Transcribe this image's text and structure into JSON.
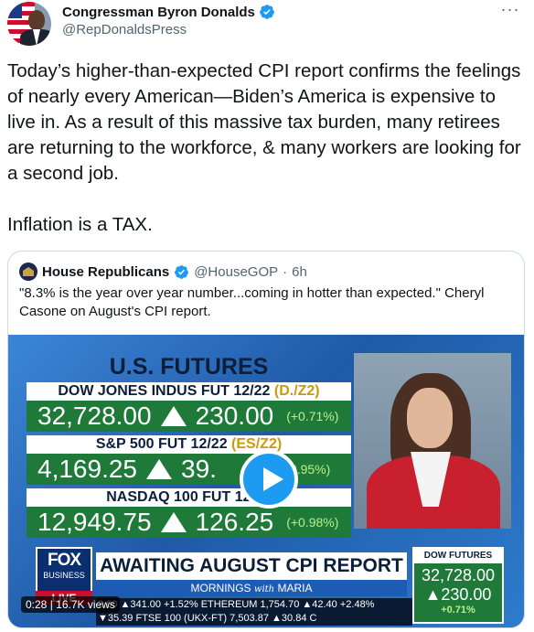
{
  "author": {
    "display_name": "Congressman Byron Donalds",
    "handle": "@RepDonaldsPress",
    "more_label": "···"
  },
  "tweet": {
    "text": "Today’s higher-than-expected CPI report confirms the feelings of nearly every American—Biden’s America is expensive to live in. As a result of this massive tax burden, many retirees are returning to the workforce, & many workers are looking for a second job.\n\nInflation is a TAX."
  },
  "quote": {
    "display_name": "House Republicans",
    "handle": "@HouseGOP",
    "separator": "·",
    "time": "6h",
    "text": "\"8.3% is the year over year number...coming in hotter than expected.\" Cheryl Casone on August's CPI report."
  },
  "video": {
    "futures_title": "U.S. FUTURES",
    "rows": [
      {
        "label": "DOW JONES INDUS FUT 12/22 ",
        "ticker": "(D./Z2)",
        "value": "32,728.00",
        "change": "230.00",
        "pct": "(+0.71%)"
      },
      {
        "label": "S&P 500 FUT 12/22 ",
        "ticker": "(ES/Z2)",
        "value": "4,169.25",
        "change": "39.",
        "pct": "0.95%)"
      },
      {
        "label": "NASDAQ 100 FUT 12/22",
        "ticker": "",
        "value": "12,949.75",
        "change": "126.25",
        "pct": "(+0.98%)"
      }
    ],
    "fox": "FOX",
    "business": "BUSINESS",
    "live": "LIVE",
    "headline": "AWAITING AUGUST CPI REPORT",
    "show_a": "MORNINGS ",
    "show_b": "with",
    "show_c": " MARIA",
    "ticker_line1": "2.00 ▲341.00 +1.52% ETHEREUM 1,754.70 ▲42.40 +2.48%",
    "ticker_line2": "▼35.39 FTSE 100 (UKX-FT) 7,503.87 ▲30.84 C",
    "dj_title": "DOW FUTURES",
    "dj_value": "32,728.00",
    "dj_change": "▲230.00",
    "dj_pct": "+0.71%",
    "duration": "0:28",
    "views": "16.7K views"
  },
  "colors": {
    "twitter_blue": "#1d9bf0",
    "text_primary": "#0f1419",
    "text_secondary": "#536471",
    "fox_green": "#1f7a3a"
  },
  "icons": {
    "verified": "verified-badge-icon",
    "more": "more-icon",
    "play": "play-icon"
  }
}
